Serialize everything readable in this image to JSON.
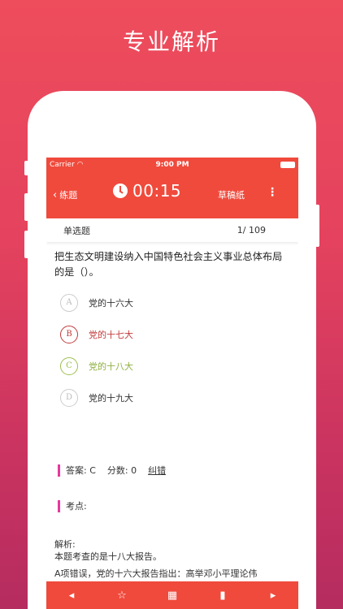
{
  "promo": {
    "title": "专业解析"
  },
  "status": {
    "carrier": "Carrier",
    "time": "9:00 PM"
  },
  "nav": {
    "back": "练题",
    "timer": "00:15",
    "scratch": "草稿纸"
  },
  "question": {
    "type": "单选题",
    "progress": "1/ 109",
    "text": "把生态文明建设纳入中国特色社会主义事业总体布局的是（）。",
    "options": [
      {
        "letter": "A",
        "text": "党的十六大"
      },
      {
        "letter": "B",
        "text": "党的十七大"
      },
      {
        "letter": "C",
        "text": "党的十八大"
      },
      {
        "letter": "D",
        "text": "党的十九大"
      }
    ]
  },
  "answer": {
    "label": "答案: C",
    "score": "分数: 0",
    "correct": "纠错"
  },
  "kaodian": "考点:",
  "analysis": {
    "label": "解析:",
    "line1": "本题考查的是十八大报告。",
    "line2": "A项错误，党的十六大报告指出：高举邓小平理论伟"
  },
  "colors": {
    "accent": "#f04a3c",
    "wrong": "#c23a3a",
    "right": "#9dbf4f",
    "marker": "#e6389e"
  }
}
